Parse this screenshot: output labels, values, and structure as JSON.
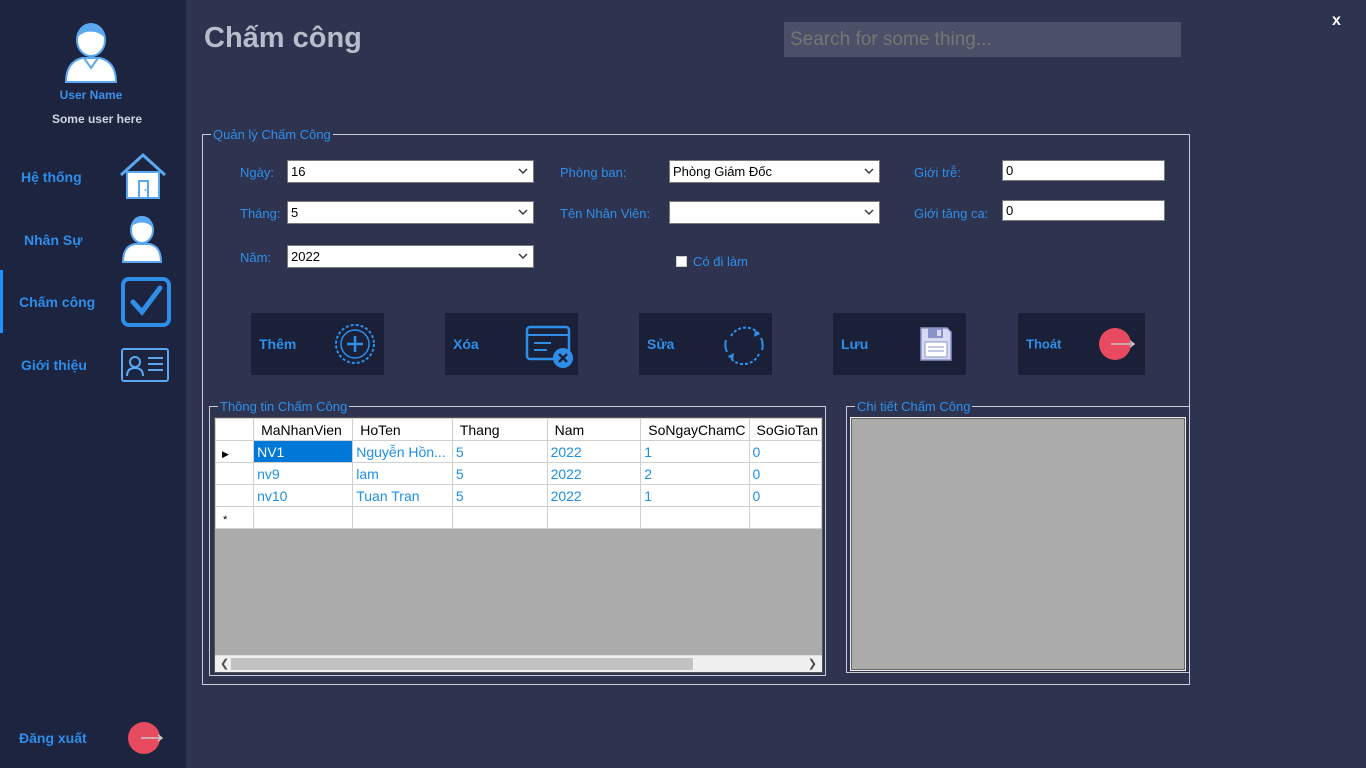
{
  "window": {
    "close_label": "x"
  },
  "sidebar": {
    "user_name": "User Name",
    "user_sub": "Some user here",
    "items": [
      {
        "label": "Hệ thống",
        "icon": "house-icon"
      },
      {
        "label": "Nhân Sự",
        "icon": "person-icon"
      },
      {
        "label": "Chấm công",
        "icon": "checkbox-icon",
        "active": true
      },
      {
        "label": "Giới thiệu",
        "icon": "id-card-icon"
      }
    ],
    "logout_label": "Đăng xuất"
  },
  "header": {
    "title": "Chấm công",
    "search_placeholder": "Search for some thing..."
  },
  "manage": {
    "title": "Quản lý Chấm Công",
    "day_label": "Ngày:",
    "day_value": "16",
    "month_label": "Tháng:",
    "month_value": "5",
    "year_label": "Năm:",
    "year_value": "2022",
    "dept_label": "Phòng ban:",
    "dept_value": "Phòng Giám Đốc",
    "emp_label": "Tên Nhân Viên:",
    "emp_value": "",
    "late_label": "Giới trễ:",
    "late_value": "0",
    "ot_label": "Giới tăng ca:",
    "ot_value": "0",
    "present_label": "Có đi làm",
    "present_checked": false,
    "buttons": {
      "add": "Thêm",
      "delete": "Xóa",
      "edit": "Sửa",
      "save": "Lưu",
      "exit": "Thoát"
    }
  },
  "info": {
    "title": "Thông tin Chấm Công",
    "columns": [
      "MaNhanVien",
      "HoTen",
      "Thang",
      "Nam",
      "SoNgayChamC",
      "SoGioTan"
    ],
    "rows": [
      [
        "NV1",
        "Nguyễn Hồn...",
        "5",
        "2022",
        "1",
        "0"
      ],
      [
        "nv9",
        "lam",
        "5",
        "2022",
        "2",
        "0"
      ],
      [
        "nv10",
        "Tuan Tran",
        "5",
        "2022",
        "1",
        "0"
      ]
    ],
    "current_row_marker": "▶",
    "new_row_marker": "*"
  },
  "detail": {
    "title": "Chi tiết Chấm Công"
  },
  "colors": {
    "accent": "#2f8fe8",
    "sidebar_bg": "#1d2440",
    "content_bg": "#2e3350",
    "button_bg": "#1a2038",
    "exit_red": "#e84a5f"
  }
}
